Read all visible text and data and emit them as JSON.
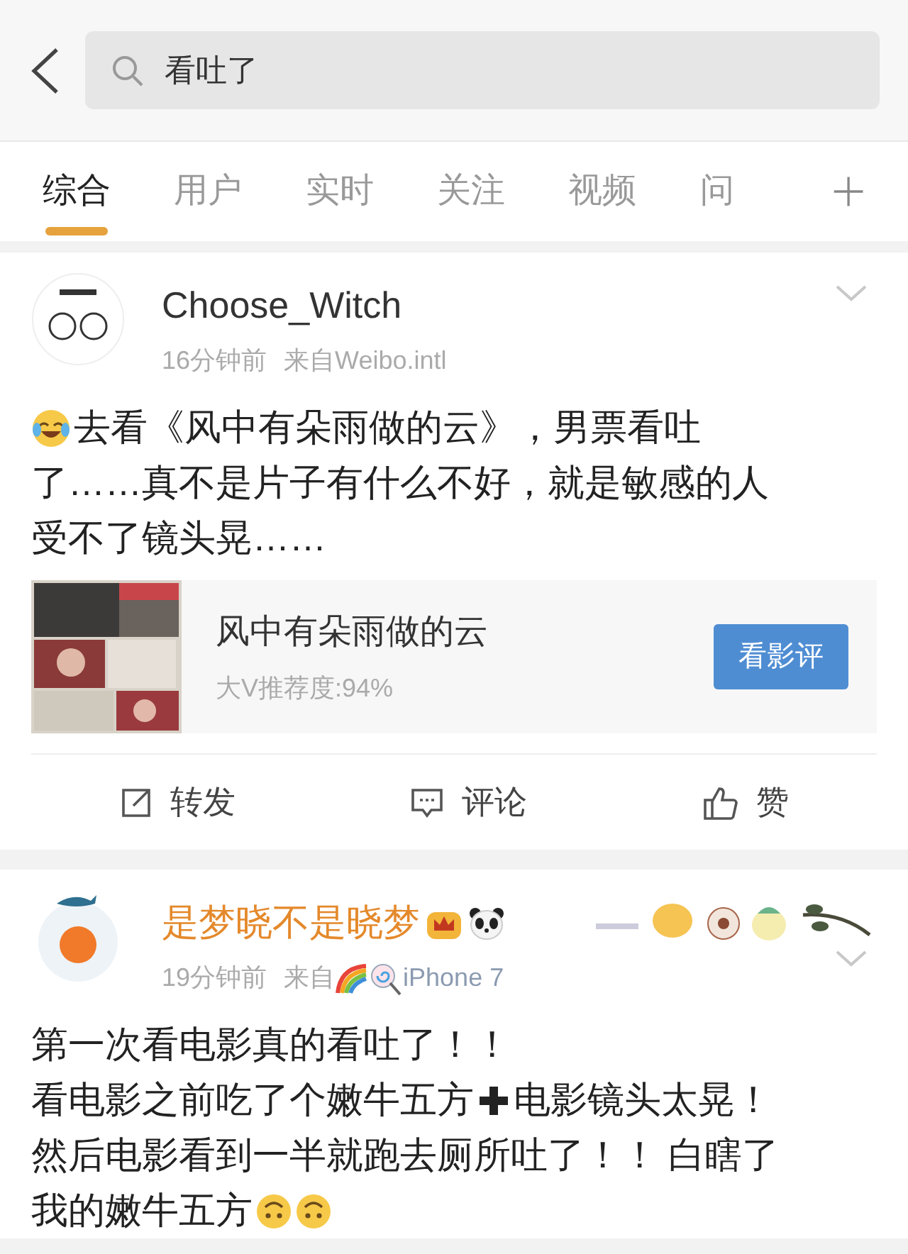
{
  "search": {
    "value": "看吐了"
  },
  "tabs": [
    {
      "label": "综合",
      "selected": true
    },
    {
      "label": "用户",
      "selected": false
    },
    {
      "label": "实时",
      "selected": false
    },
    {
      "label": "关注",
      "selected": false
    },
    {
      "label": "视频",
      "selected": false
    },
    {
      "label": "问",
      "selected": false
    }
  ],
  "posts": [
    {
      "user": "Choose_Witch",
      "vip": false,
      "time": "16分钟前",
      "source_prefix": "来自",
      "source": "Weibo.intl",
      "decorated": false,
      "lines": [
        [
          {
            "kind": "laugh"
          },
          {
            "kind": "text",
            "text": "去看《风中有朵雨做的云》，男票看吐"
          }
        ],
        [
          {
            "kind": "text",
            "text": "了……真不是片子有什么不好，就是敏感的人"
          }
        ],
        [
          {
            "kind": "text",
            "text": "受不了镜头晃……"
          }
        ]
      ],
      "card": {
        "title": "风中有朵雨做的云",
        "subtitle": "大V推荐度:94%",
        "button": "看影评"
      },
      "actions": [
        "转发",
        "评论",
        "赞"
      ]
    },
    {
      "user": "是梦晓不是晓梦",
      "vip": true,
      "name_badges": [
        {
          "kind": "crown"
        },
        {
          "kind": "panda"
        }
      ],
      "time": "19分钟前",
      "source_prefix": "来自",
      "source_badges": [
        {
          "kind": "rainbow"
        },
        {
          "kind": "lollipop"
        }
      ],
      "source": "iPhone 7",
      "decorated": true,
      "lines": [
        [
          {
            "kind": "text",
            "text": "第一次看电影真的看吐了！！"
          }
        ],
        [
          {
            "kind": "text",
            "text": "看电影之前吃了个嫩牛五方"
          },
          {
            "kind": "plus"
          },
          {
            "kind": "text",
            "text": "电影镜头太晃！"
          }
        ],
        [
          {
            "kind": "text",
            "text": "然后电影看到一半就跑去厕所吐了！！ 白瞎了"
          }
        ],
        [
          {
            "kind": "text",
            "text": "我的嫩牛五方"
          },
          {
            "kind": "upside"
          },
          {
            "kind": "upside"
          }
        ]
      ]
    }
  ]
}
